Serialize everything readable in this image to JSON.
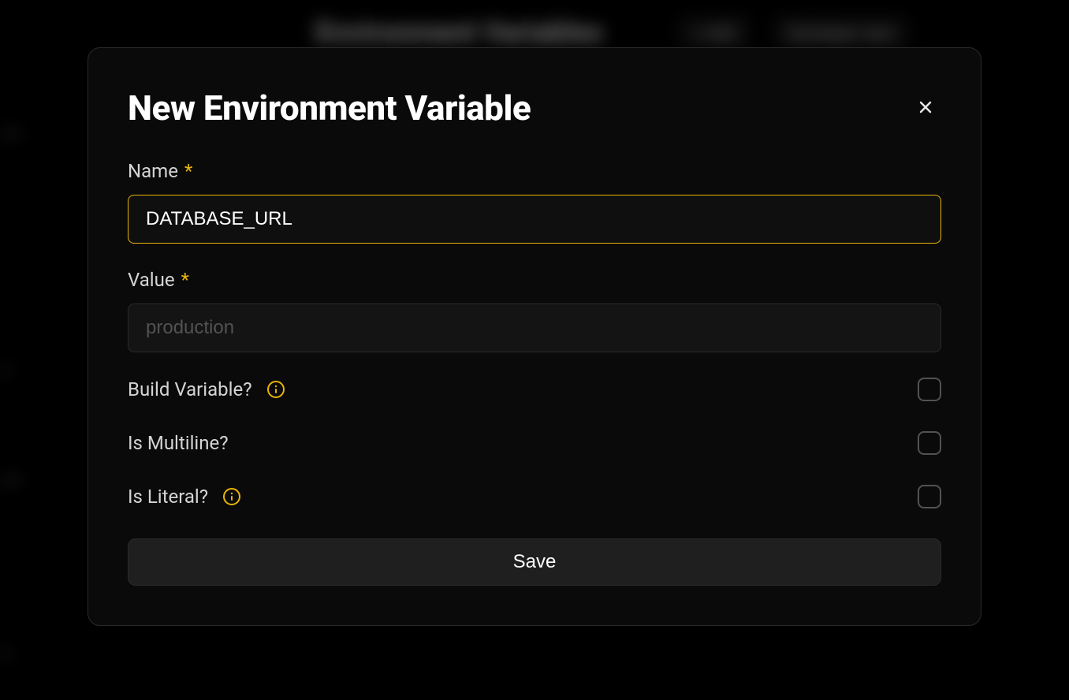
{
  "background": {
    "title": "Environment Variables",
    "button1": "+ Add",
    "button2": "Developer view"
  },
  "modal": {
    "title": "New Environment Variable",
    "nameLabel": "Name",
    "nameValue": "DATABASE_URL",
    "valueLabel": "Value",
    "valuePlaceholder": "production",
    "buildVariableLabel": "Build Variable?",
    "isMultilineLabel": "Is Multiline?",
    "isLiteralLabel": "Is Literal?",
    "saveButtonLabel": "Save",
    "requiredMarker": "*"
  }
}
